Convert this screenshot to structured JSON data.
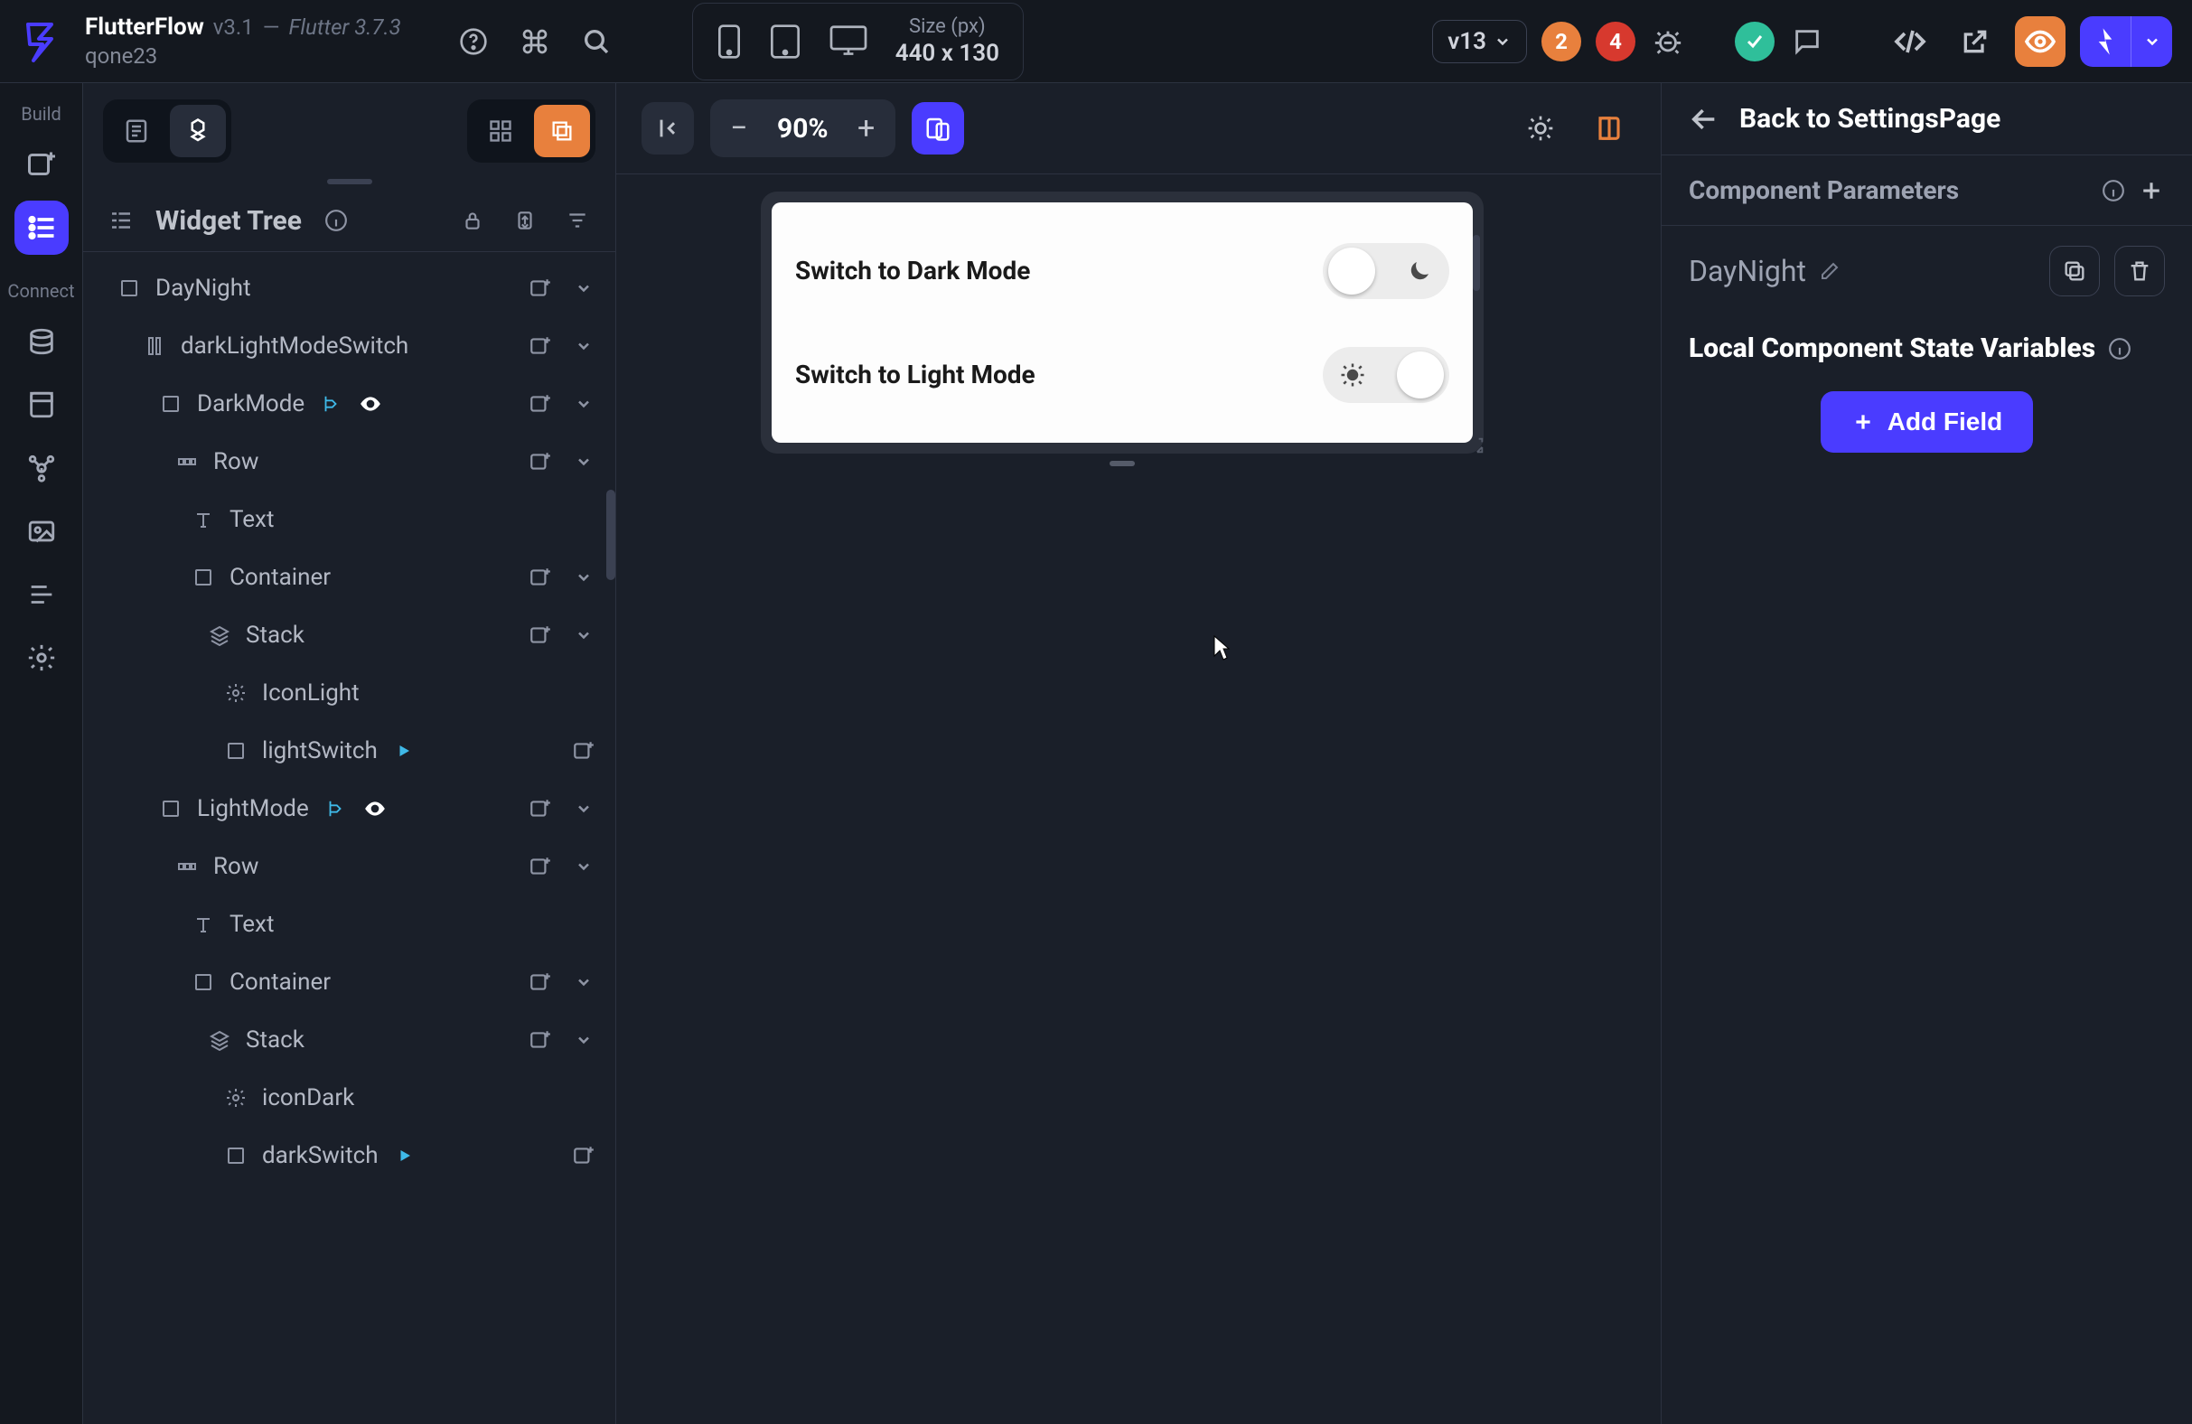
{
  "brand": {
    "name": "FlutterFlow",
    "version": "v3.1",
    "dash": "—",
    "flutter": "Flutter 3.7.3",
    "user": "qone23"
  },
  "size": {
    "label": "Size (px)",
    "value": "440 x 130"
  },
  "version_pill": "v13",
  "badges": {
    "orange": "2",
    "red": "4"
  },
  "zoom": "90%",
  "rail": {
    "build": "Build",
    "connect": "Connect"
  },
  "tree": {
    "title": "Widget Tree",
    "items": [
      {
        "name": "DayNight"
      },
      {
        "name": "darkLightModeSwitch"
      },
      {
        "name": "DarkMode"
      },
      {
        "name": "Row"
      },
      {
        "name": "Text"
      },
      {
        "name": "Container"
      },
      {
        "name": "Stack"
      },
      {
        "name": "IconLight"
      },
      {
        "name": "lightSwitch"
      },
      {
        "name": "LightMode"
      },
      {
        "name": "Row"
      },
      {
        "name": "Text"
      },
      {
        "name": "Container"
      },
      {
        "name": "Stack"
      },
      {
        "name": "iconDark"
      },
      {
        "name": "darkSwitch"
      }
    ]
  },
  "canvas": {
    "dark_label": "Switch to Dark Mode",
    "light_label": "Switch to Light Mode"
  },
  "props": {
    "back": "Back to SettingsPage",
    "params_title": "Component Parameters",
    "component_name": "DayNight",
    "state_title": "Local Component State Variables",
    "add_field": "Add Field"
  }
}
